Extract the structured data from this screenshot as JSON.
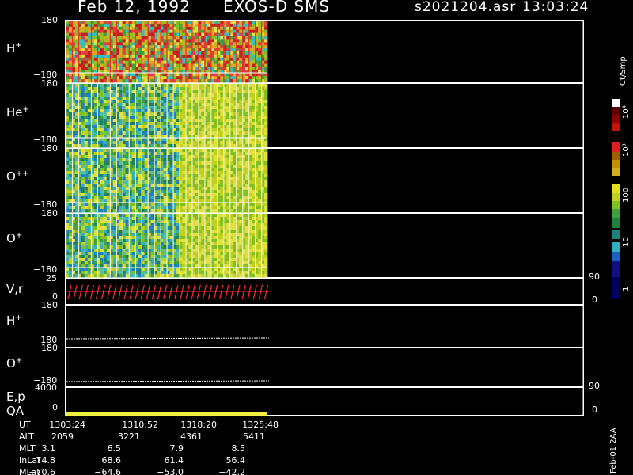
{
  "header": {
    "date": "Feb 12, 1992",
    "mission": "EXOS-D SMS",
    "file": "s2021204.asr",
    "time": "13:03:24"
  },
  "panels": [
    {
      "id": "h_plus",
      "label": "H",
      "sup": "+",
      "top_tick": "180",
      "bottom_tick": "−180"
    },
    {
      "id": "he_plus",
      "label": "He",
      "sup": "+",
      "top_tick": "180",
      "bottom_tick": "−180"
    },
    {
      "id": "o_pp",
      "label": "O",
      "sup": "++",
      "top_tick": "180",
      "bottom_tick": "−180"
    },
    {
      "id": "o_plus",
      "label": "O",
      "sup": "+",
      "top_tick": "180",
      "bottom_tick": "−180"
    },
    {
      "id": "vr",
      "label": "V,r",
      "sup": "",
      "top_tick": "25",
      "bottom_tick": "0",
      "right_top": "90",
      "right_bottom": "0"
    },
    {
      "id": "h_plus_2",
      "label": "H",
      "sup": "+",
      "top_tick": "180",
      "bottom_tick": "−180"
    },
    {
      "id": "o_plus_2",
      "label": "O",
      "sup": "+",
      "top_tick": "180",
      "bottom_tick": "−180"
    },
    {
      "id": "ep",
      "label": "E,p",
      "sup": "",
      "top_tick": "4000",
      "bottom_tick": "0",
      "right_top": "90",
      "right_bottom": "0"
    }
  ],
  "qa_label": "QA",
  "colorbar": {
    "unit": "Ct/Smp",
    "ticks": [
      "10⁴",
      "10³",
      "100",
      "10",
      "1"
    ]
  },
  "side_note": "Feb-01 2AA",
  "table": {
    "rows": [
      {
        "label": "UT",
        "values": [
          "1303:24",
          "1310:52",
          "1318:20",
          "1325:48"
        ]
      },
      {
        "label": "ALT",
        "values": [
          "2059",
          "3221",
          "4361",
          "5411"
        ]
      },
      {
        "label": "MLT",
        "values": [
          "3.1",
          "6.5",
          "7.9",
          "8.5"
        ]
      },
      {
        "label": "InLat",
        "values": [
          "74.8",
          "68.6",
          "61.4",
          "56.4"
        ]
      },
      {
        "label": "MLat",
        "values": [
          "−70.6",
          "−64.6",
          "−53.0",
          "−42.2"
        ]
      }
    ]
  },
  "colors": {
    "axis": "#ffffff",
    "qa_bar": "#f0f040",
    "arrows": "#ff3030"
  }
}
